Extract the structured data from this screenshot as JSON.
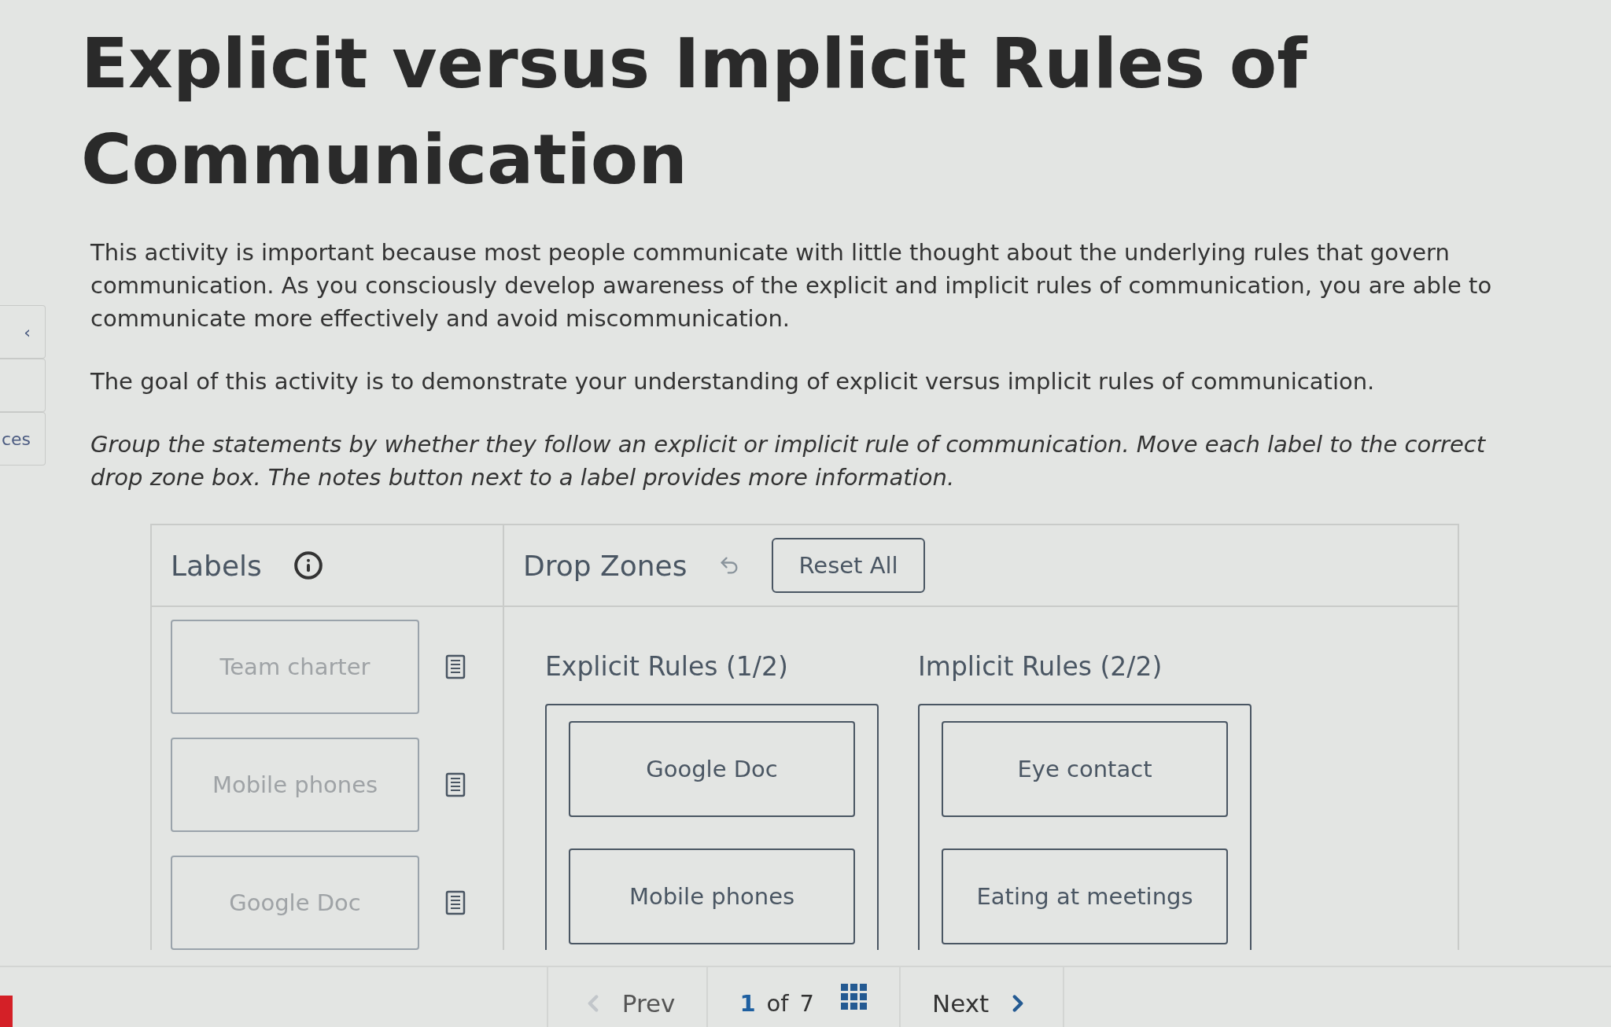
{
  "side_tabs": {
    "top": "‹",
    "bottom": "ces"
  },
  "title": "Explicit versus Implicit Rules of Communication",
  "paragraphs": [
    {
      "kind": "plain",
      "text": "This activity is important because most people communicate with little thought about the underlying rules that govern communication. As you consciously develop awareness of the explicit and implicit rules of communication, you are able to communicate more effectively and avoid miscommunication."
    },
    {
      "kind": "plain",
      "text": "The goal of this activity is to demonstrate your understanding of explicit versus implicit rules of communication."
    },
    {
      "kind": "instruction",
      "text": "Group the statements by whether they follow an explicit or implicit rule of communication. Move each label to the correct drop zone box. The notes button next to a label provides more information."
    }
  ],
  "labels_panel": {
    "heading": "Labels",
    "items": [
      {
        "text": "Team charter",
        "placed": true
      },
      {
        "text": "Mobile phones",
        "placed": true
      },
      {
        "text": "Google Doc",
        "placed": true
      }
    ]
  },
  "drop_zones": {
    "heading": "Drop Zones",
    "reset": "Reset All",
    "zones": [
      {
        "title": "Explicit Rules (1/2)",
        "items": [
          "Google Doc",
          "Mobile phones"
        ]
      },
      {
        "title": "Implicit Rules (2/2)",
        "items": [
          "Eye contact",
          "Eating at meetings"
        ]
      }
    ]
  },
  "pager": {
    "prev": {
      "label": "Prev",
      "disabled": true
    },
    "current": "1",
    "of": "of",
    "total": "7",
    "next": {
      "label": "Next",
      "disabled": false
    }
  }
}
